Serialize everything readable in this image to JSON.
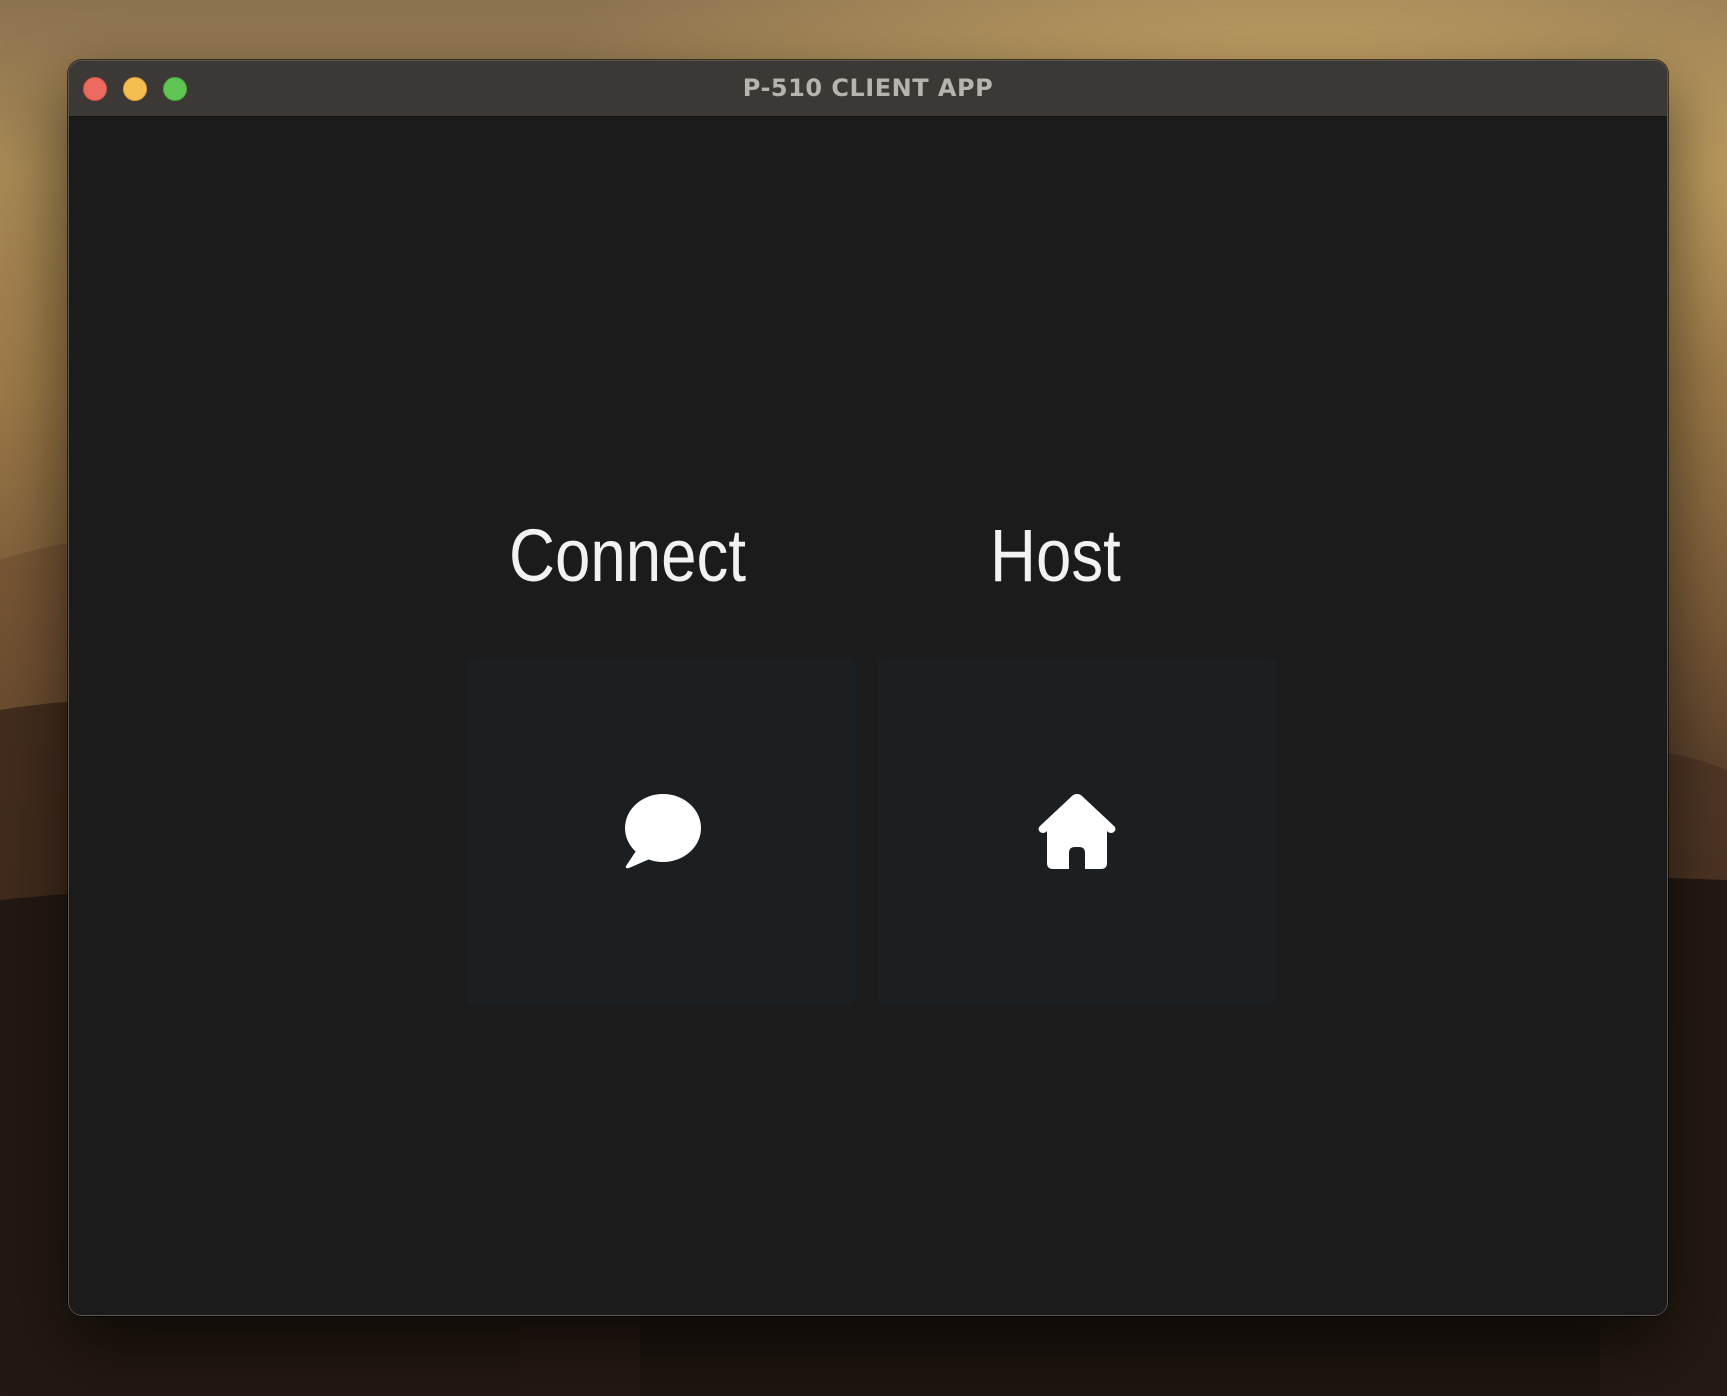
{
  "window": {
    "title": "P-510 CLIENT APP",
    "controls": {
      "close": "close",
      "minimize": "minimize",
      "maximize": "zoom"
    }
  },
  "main": {
    "options": [
      {
        "label": "Connect",
        "icon": "speech-bubble-icon"
      },
      {
        "label": "Host",
        "icon": "home-icon"
      }
    ]
  },
  "colors": {
    "window_background": "#1b1b1b",
    "titlebar": "#3c3835",
    "tile_background": "#1c1f22",
    "label_text": "#f2f2f2",
    "icon": "#ffffff"
  }
}
